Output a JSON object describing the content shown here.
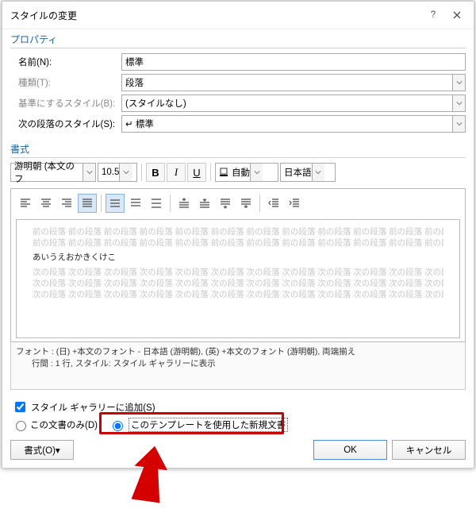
{
  "titlebar": {
    "title": "スタイルの変更"
  },
  "properties": {
    "header": "プロパティ",
    "name_label": "名前(N):",
    "name_value": "標準",
    "type_label": "種類(T):",
    "type_value": "段落",
    "base_label": "基準にするスタイル(B):",
    "base_value": "(スタイルなし)",
    "next_label": "次の段落のスタイル(S):",
    "next_value": "↵ 標準"
  },
  "format": {
    "header": "書式",
    "font_name": "游明朝 (本文のフ",
    "font_size": "10.5",
    "color_label": "自動",
    "lang": "日本語"
  },
  "preview": {
    "prev_line": "前の段落 前の段落 前の段落 前の段落 前の段落 前の段落 前の段落 前の段落 前の段落 前の段落 前の段落 前の段落 前の段落 前の段落 前の段落 前の段落 前の段落 前の段落",
    "sample": "あいうえおかきくけこ",
    "next_line": "次の段落 次の段落 次の段落 次の段落 次の段落 次の段落 次の段落 次の段落 次の段落 次の段落 次の段落 次の段落 次の段落 次の段落 次の段落 次の段落 次の段落 次の段落 次の段落 次の段落 次の段落 次の段落 次の段落 次の段落"
  },
  "description": {
    "line1": "フォント : (日) +本文のフォント - 日本語 (游明朝), (英) +本文のフォント (游明朝), 両端揃え",
    "line2": "行間 :  1 行, スタイル: スタイル ギャラリーに表示"
  },
  "footer": {
    "add_to_gallery": "スタイル ギャラリーに追加(S)",
    "this_doc_only": "この文書のみ(D)",
    "use_template": "このテンプレートを使用した新規文書",
    "format_btn": "書式(O)▾",
    "ok": "OK",
    "cancel": "キャンセル"
  }
}
